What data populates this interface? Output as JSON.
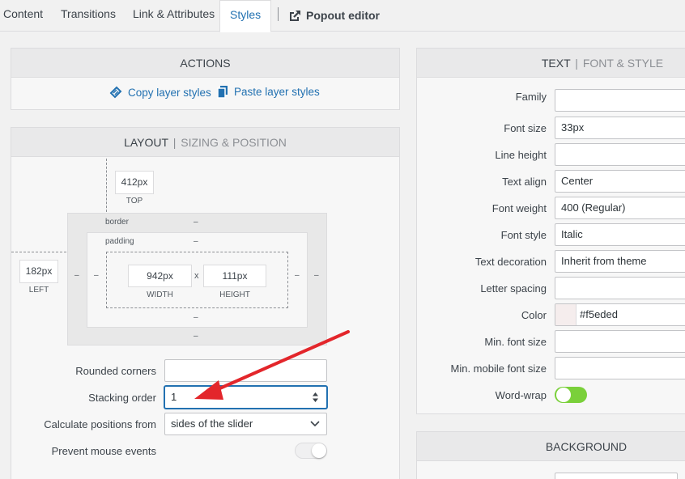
{
  "tabs": {
    "content": "Content",
    "transitions": "Transitions",
    "link": "Link & Attributes",
    "styles": "Styles",
    "popout": "Popout editor"
  },
  "actions": {
    "title": "ACTIONS",
    "copy": "Copy layer styles",
    "paste": "Paste layer styles"
  },
  "layout": {
    "title": "LAYOUT",
    "separator": "|",
    "subtitle": "SIZING & POSITION",
    "top_value": "412px",
    "top_label": "TOP",
    "left_value": "182px",
    "left_label": "LEFT",
    "border_label": "border",
    "padding_label": "padding",
    "width_value": "942px",
    "width_label": "WIDTH",
    "height_value": "111px",
    "height_label": "HEIGHT",
    "times": "x",
    "dash": "–",
    "rounded_label": "Rounded corners",
    "rounded_value": "",
    "stacking_label": "Stacking order",
    "stacking_value": "1",
    "calc_label": "Calculate positions from",
    "calc_value": "sides of the slider",
    "prevent_label": "Prevent mouse events",
    "prevent_on": false
  },
  "text_panel": {
    "title": "TEXT",
    "separator": "|",
    "subtitle": "FONT & STYLE",
    "rows": [
      {
        "label": "Family",
        "value": ""
      },
      {
        "label": "Font size",
        "value": "33px"
      },
      {
        "label": "Line height",
        "value": ""
      },
      {
        "label": "Text align",
        "value": "Center"
      },
      {
        "label": "Font weight",
        "value": "400 (Regular)"
      },
      {
        "label": "Font style",
        "value": "Italic"
      },
      {
        "label": "Text decoration",
        "value": "Inherit from theme"
      },
      {
        "label": "Letter spacing",
        "value": ""
      },
      {
        "label": "Color",
        "value": "#f5eded"
      },
      {
        "label": "Min. font size",
        "value": ""
      },
      {
        "label": "Min. mobile font size",
        "value": ""
      },
      {
        "label": "Word-wrap",
        "value": ""
      }
    ],
    "color_swatch": "#f5eded",
    "wordwrap_on": true
  },
  "background_panel": {
    "title": "BACKGROUND"
  },
  "colors": {
    "accent": "#2271b1",
    "toggle_on": "#7ad03a",
    "arrow": "#e3262b"
  }
}
